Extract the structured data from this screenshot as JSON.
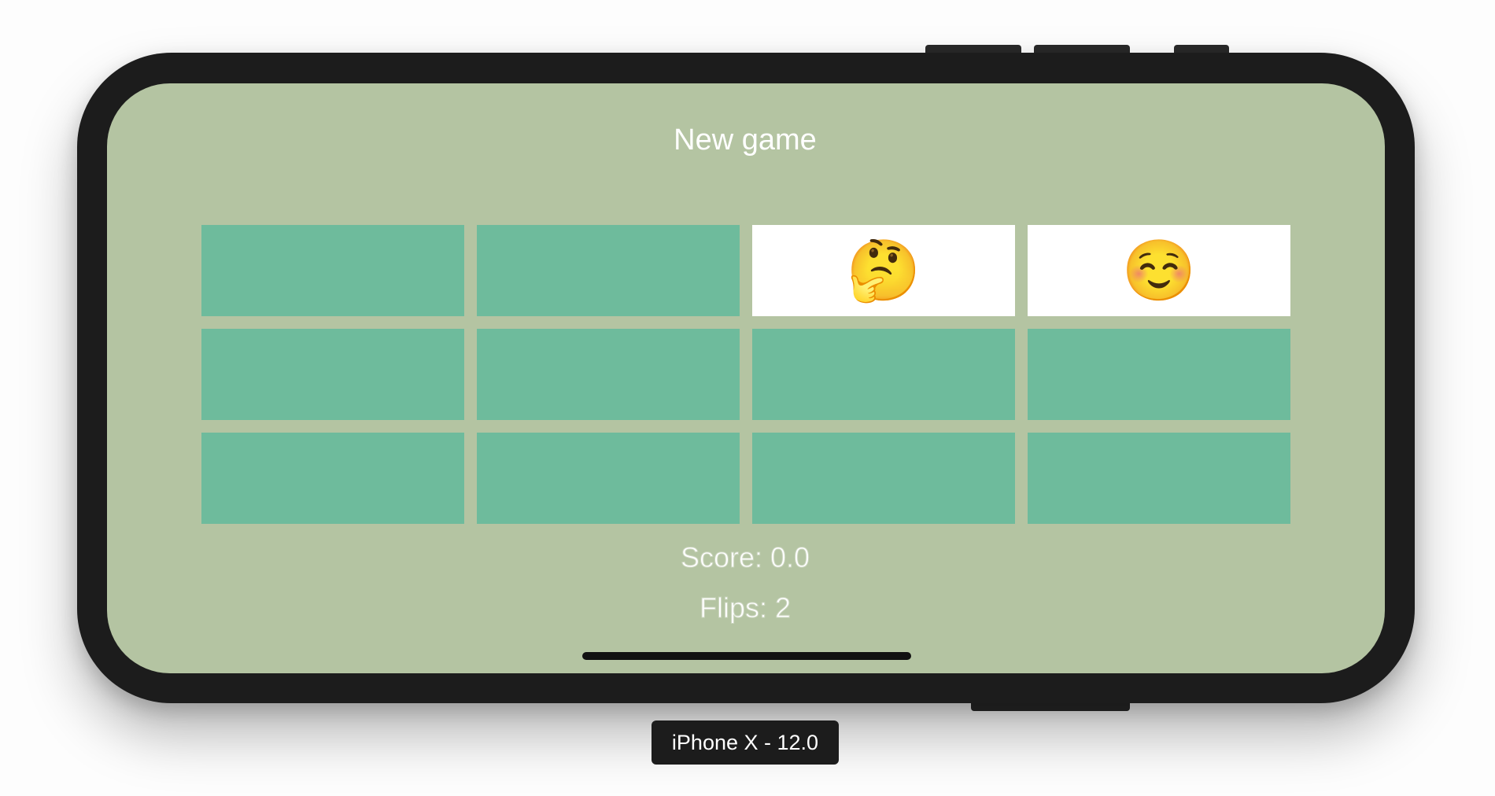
{
  "app": {
    "new_game_label": "New game",
    "score_text": "Score: 0.0",
    "flips_text": "Flips: 2"
  },
  "cards": [
    {
      "face_up": false,
      "emoji": ""
    },
    {
      "face_up": false,
      "emoji": ""
    },
    {
      "face_up": true,
      "emoji": "🤔"
    },
    {
      "face_up": true,
      "emoji": "☺️"
    },
    {
      "face_up": false,
      "emoji": ""
    },
    {
      "face_up": false,
      "emoji": ""
    },
    {
      "face_up": false,
      "emoji": ""
    },
    {
      "face_up": false,
      "emoji": ""
    },
    {
      "face_up": false,
      "emoji": ""
    },
    {
      "face_up": false,
      "emoji": ""
    },
    {
      "face_up": false,
      "emoji": ""
    },
    {
      "face_up": false,
      "emoji": ""
    }
  ],
  "simulator": {
    "device_label": "iPhone X - 12.0"
  },
  "colors": {
    "background": "#b4c4a2",
    "card_back": "#6ebb9c",
    "card_face": "#ffffff",
    "device_frame": "#1c1c1c"
  }
}
